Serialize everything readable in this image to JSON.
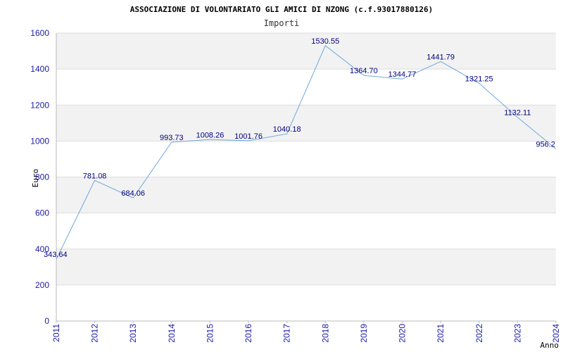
{
  "chart_data": {
    "type": "line",
    "title": "ASSOCIAZIONE DI VOLONTARIATO GLI AMICI DI NZONG (c.f.93017880126)",
    "subtitle": "Importi",
    "xlabel": "Anno",
    "ylabel": "Euro",
    "ylim": [
      0,
      1600
    ],
    "yticks": [
      "0",
      "200",
      "400",
      "600",
      "800",
      "1000",
      "1200",
      "1400",
      "1600"
    ],
    "categories": [
      "2011",
      "2012",
      "2013",
      "2014",
      "2015",
      "2016",
      "2017",
      "2018",
      "2019",
      "2020",
      "2021",
      "2022",
      "2023",
      "2024"
    ],
    "values": [
      343.64,
      781.08,
      684.06,
      993.73,
      1008.26,
      1001.76,
      1040.18,
      1530.55,
      1364.7,
      1344.77,
      1441.79,
      1321.25,
      1132.11,
      956.2
    ],
    "labels": [
      "343.64",
      "781.08",
      "684.06",
      "993.73",
      "1008.26",
      "1001.76",
      "1040.18",
      "1530.55",
      "1364.70",
      "1344.77",
      "1441.79",
      "1321.25",
      "1132.11",
      "956.2"
    ],
    "grid": true,
    "line_color": "#6fa8dc",
    "band_color": "#f2f2f2"
  }
}
